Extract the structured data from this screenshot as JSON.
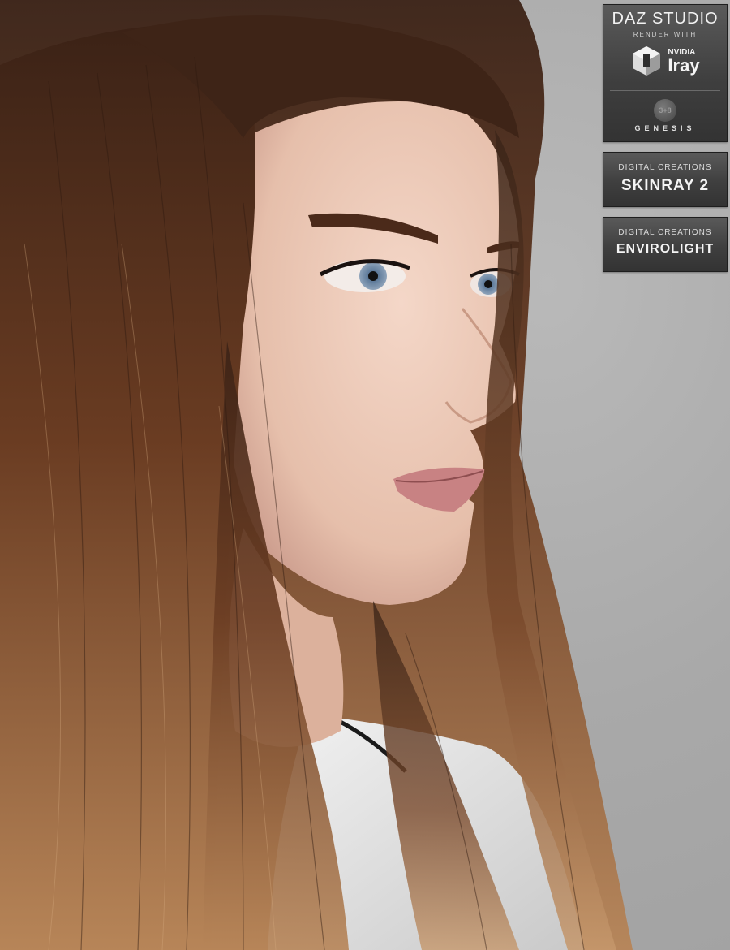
{
  "daz_badge": {
    "title": "DAZ STUDIO",
    "subtitle": "RENDER WITH",
    "nvidia": "NVIDIA",
    "iray": "Iray",
    "genesis_mark": "3+8",
    "genesis": "GENESIS"
  },
  "skinray_badge": {
    "maker": "DIGITAL CREATIONS",
    "product": "SKINRAY 2"
  },
  "envirolight_badge": {
    "maker": "DIGITAL CREATIONS",
    "product": "ENVIROLIGHT"
  },
  "colors": {
    "background": "#a7a7a7",
    "hair": "#5a3220",
    "skin": "#e8c3b0",
    "badge": "#3f3f3f"
  },
  "icons": {
    "iray_logo": "nvidia-cube-icon"
  }
}
